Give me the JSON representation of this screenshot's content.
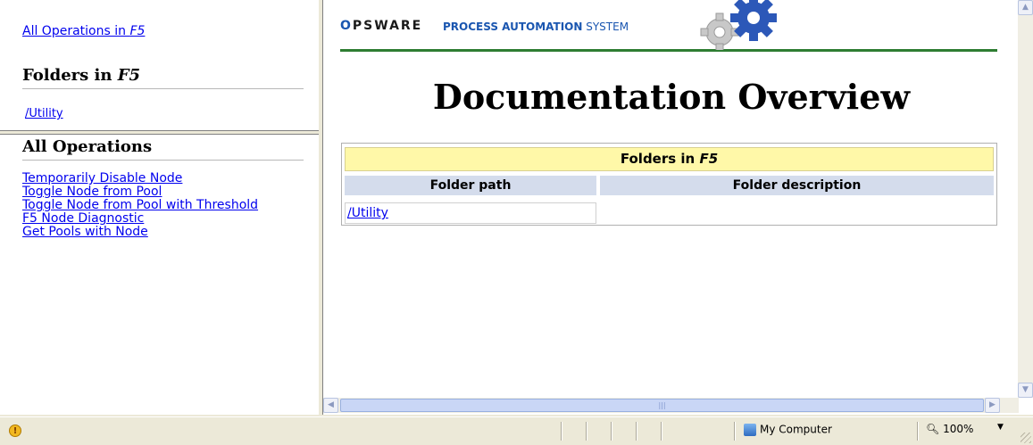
{
  "nav_top": {
    "all_operations_link": {
      "prefix": "All Operations in ",
      "em": "F5"
    },
    "folders_heading": {
      "prefix": "Folders in ",
      "em": "F5"
    },
    "folder_link": "/Utility"
  },
  "nav_bottom": {
    "heading": "All Operations",
    "operations": [
      "Temporarily Disable Node",
      "Toggle Node from Pool",
      "Toggle Node from Pool with Threshold",
      "F5 Node Diagnostic",
      "Get Pools with Node"
    ]
  },
  "banner": {
    "logo_o": "O",
    "logo_rest": "PSWARE",
    "title_bold": "PROCESS AUTOMATION",
    "title_thin": " SYSTEM",
    "accent_color": "#2e7d32"
  },
  "main": {
    "heading": "Documentation Overview",
    "table": {
      "title_prefix": "Folders in ",
      "title_em": "F5",
      "columns": [
        "Folder path",
        "Folder description"
      ],
      "rows": [
        {
          "path": "/Utility",
          "description": ""
        }
      ]
    }
  },
  "scrollbars": {
    "up": "▲",
    "down": "▼",
    "left": "◀",
    "right": "▶",
    "thumb_grip": "|||"
  },
  "statusbar": {
    "warning_icon": "!",
    "zone": "My Computer",
    "zoom": "100%",
    "zoom_arrow": "▼"
  }
}
